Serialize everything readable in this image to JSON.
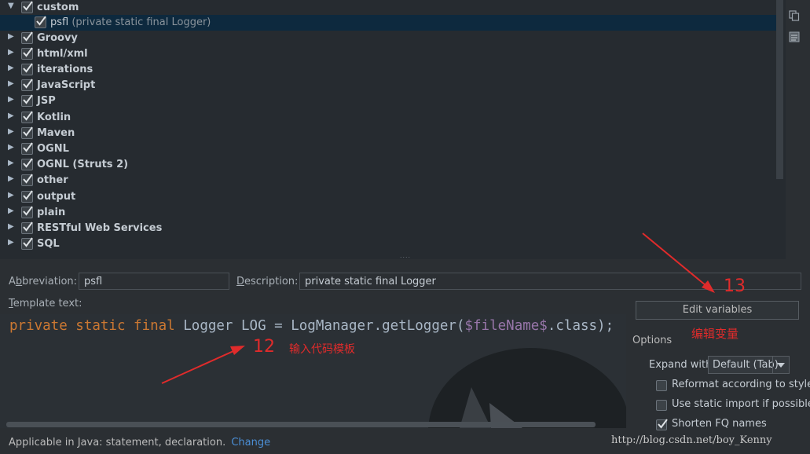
{
  "tree": {
    "items": [
      {
        "label": "custom",
        "expanded": true,
        "checked": true
      },
      {
        "label": "psfl",
        "description": "(private static final Logger)",
        "child": true,
        "selected": true,
        "checked": true
      },
      {
        "label": "Groovy",
        "checked": true
      },
      {
        "label": "html/xml",
        "checked": true
      },
      {
        "label": "iterations",
        "checked": true
      },
      {
        "label": "JavaScript",
        "checked": true
      },
      {
        "label": "JSP",
        "checked": true
      },
      {
        "label": "Kotlin",
        "checked": true
      },
      {
        "label": "Maven",
        "checked": true
      },
      {
        "label": "OGNL",
        "checked": true
      },
      {
        "label": "OGNL (Struts 2)",
        "checked": true
      },
      {
        "label": "other",
        "checked": true
      },
      {
        "label": "output",
        "checked": true
      },
      {
        "label": "plain",
        "checked": true
      },
      {
        "label": "RESTful Web Services",
        "checked": true
      },
      {
        "label": "SQL",
        "checked": true
      }
    ],
    "side_icons": [
      "copy-icon",
      "notes-icon"
    ]
  },
  "form": {
    "abbreviation_prefix": "A",
    "abbreviation_mnemonic": "b",
    "abbreviation_rest": "breviation:",
    "abbreviation_value": "psfl",
    "description_mnemonic": "D",
    "description_rest": "escription:",
    "description_value": "private static final Logger",
    "template_text_mnemonic": "T",
    "template_text_rest": "emplate text:"
  },
  "editor": {
    "code_keywords": "private static final",
    "code_middle": " Logger LOG = LogManager.getLogger(",
    "code_variable": "$fileName$",
    "code_end": ".class);"
  },
  "options": {
    "edit_variables_label": "Edit variables",
    "heading": "Options",
    "expand_with_label": "Expand with",
    "expand_with_value": "Default (Tab)",
    "reformat_label": "Reformat according to style",
    "reformat_checked": false,
    "static_import_label": "Use static import if possible",
    "static_import_checked": false,
    "shorten_fq_label": "Shorten FQ names",
    "shorten_fq_checked": true
  },
  "footer": {
    "applicable_text": "Applicable in Java: statement, declaration.",
    "change_link": "Change"
  },
  "annotations": {
    "num_12": "12",
    "num_13": "13",
    "note_template": "输入代码模板",
    "note_edit_vars": "编辑变量",
    "watermark": "http://blog.csdn.net/boy_Kenny",
    "color": "#e02b2b"
  },
  "colors": {
    "accent_link": "#4b8fd6",
    "selection": "#0d293e",
    "checkmark": "#dfe3e6"
  }
}
